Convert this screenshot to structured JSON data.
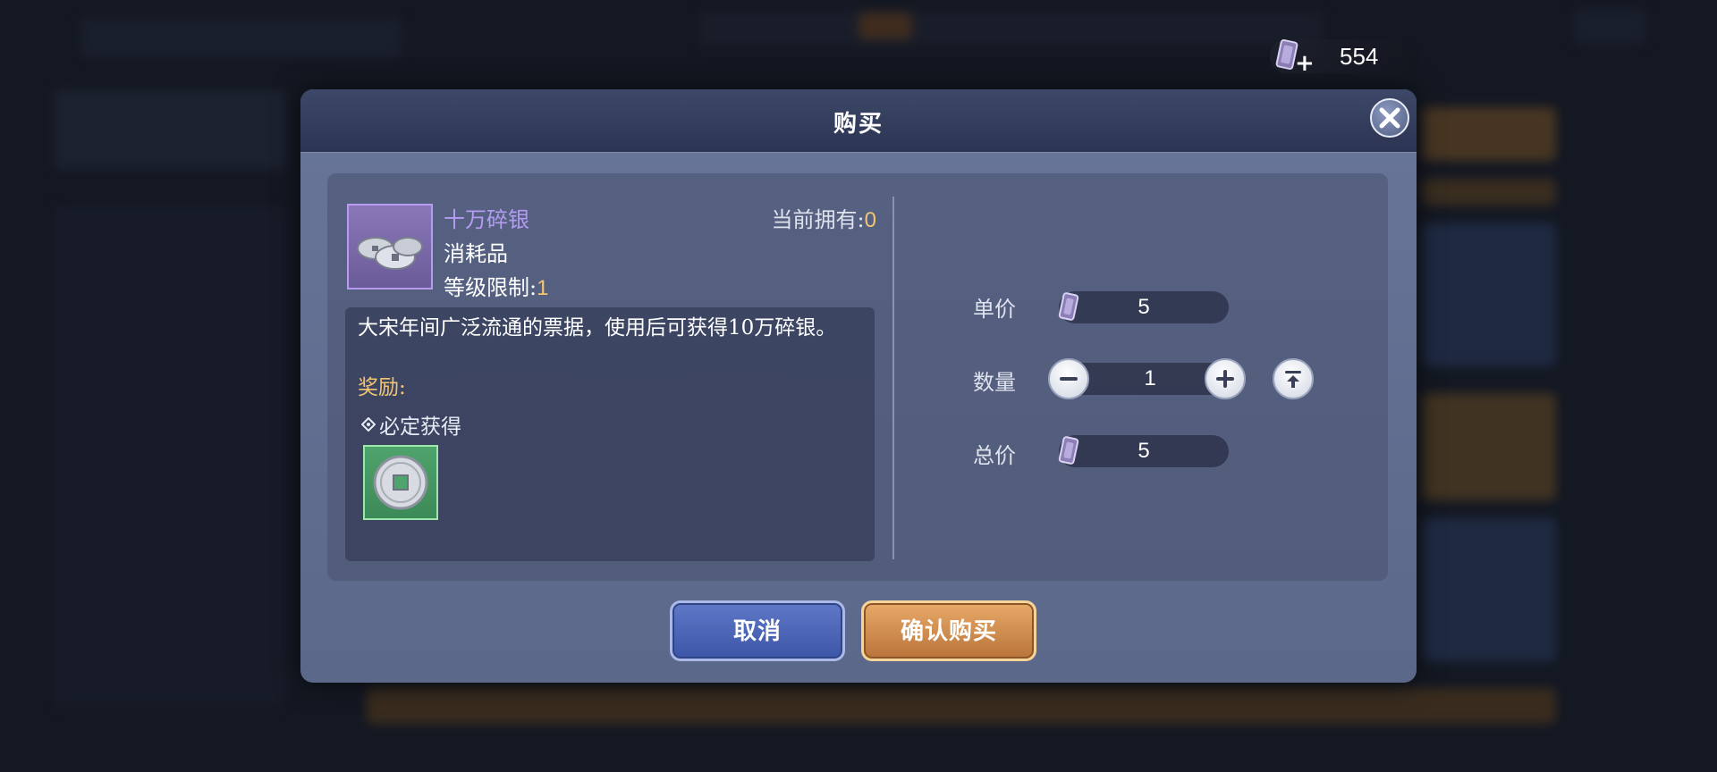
{
  "currency": {
    "amount": "554",
    "icon": "ticket-icon",
    "add_icon": "plus-icon"
  },
  "dialog": {
    "title": "购买",
    "close_icon": "close-icon",
    "item": {
      "name": "十万碎银",
      "type": "消耗品",
      "level_label": "等级限制:",
      "level_value": "1",
      "owned_label": "当前拥有:",
      "owned_value": "0",
      "icon": "silver-coins-icon"
    },
    "description": {
      "text": "大宋年间广泛流通的票据，使用后可获得10万碎银。",
      "reward_label": "奖励:",
      "guarantee_label": "必定获得",
      "reward_icon": "silver-coin-icon"
    },
    "purchase": {
      "unit_price_label": "单价",
      "unit_price": "5",
      "quantity_label": "数量",
      "quantity": "1",
      "total_label": "总价",
      "total": "5"
    },
    "buttons": {
      "cancel": "取消",
      "confirm": "确认购买"
    }
  },
  "colors": {
    "accent_gold": "#f2c572",
    "item_name_purple": "#b49cf2",
    "cancel_blue": "#4a63b6",
    "confirm_orange": "#d28f52"
  }
}
